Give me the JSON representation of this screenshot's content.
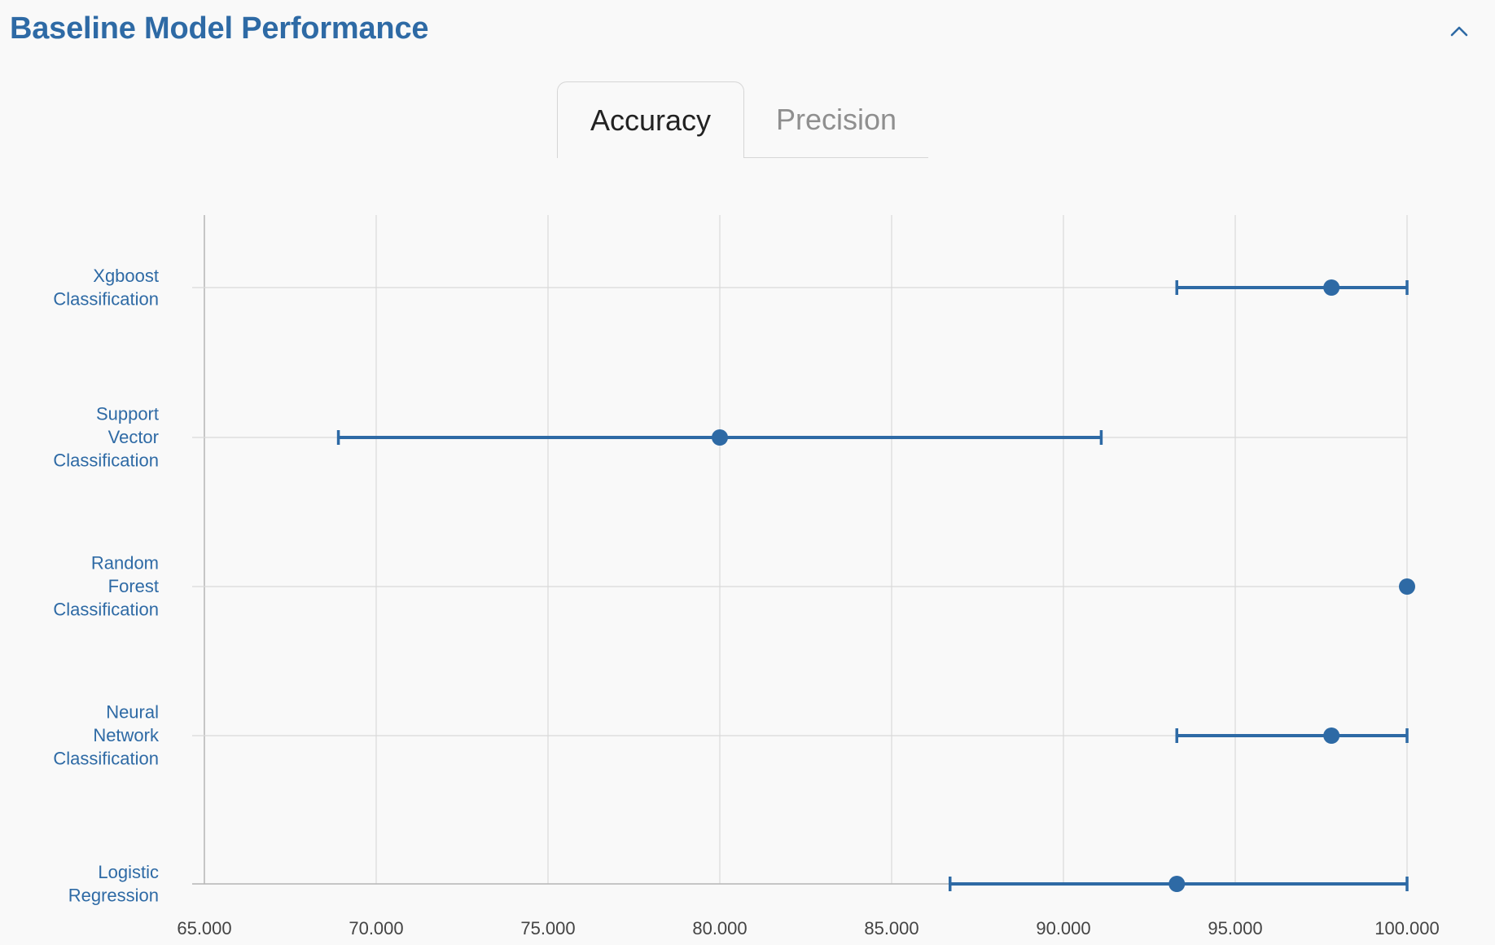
{
  "header": {
    "title": "Baseline Model Performance",
    "collapse_icon": "chevron-up-icon"
  },
  "tabs": [
    {
      "label": "Accuracy",
      "active": true
    },
    {
      "label": "Precision",
      "active": false
    }
  ],
  "colors": {
    "accent": "#2e6aa5",
    "grid": "#d9d9d9",
    "axis": "#b5b5b5"
  },
  "chart_data": {
    "type": "scatter",
    "orientation": "horizontal-error-bars",
    "categories": [
      "Xgboost Classification",
      "Support Vector Classification",
      "Random Forest Classification",
      "Neural Network Classification",
      "Logistic Regression"
    ],
    "series": [
      {
        "values": [
          97.8,
          80.0,
          100.0,
          97.8,
          93.3
        ],
        "lower": [
          93.3,
          68.9,
          100.0,
          93.3,
          86.7
        ],
        "upper": [
          100.0,
          91.1,
          100.0,
          100.0,
          100.0
        ]
      }
    ],
    "xlim": [
      65,
      100
    ],
    "xticks": [
      "65.000",
      "70.000",
      "75.000",
      "80.000",
      "85.000",
      "90.000",
      "95.000",
      "100.000"
    ],
    "grid": true,
    "title": "",
    "xlabel": "",
    "ylabel": ""
  }
}
